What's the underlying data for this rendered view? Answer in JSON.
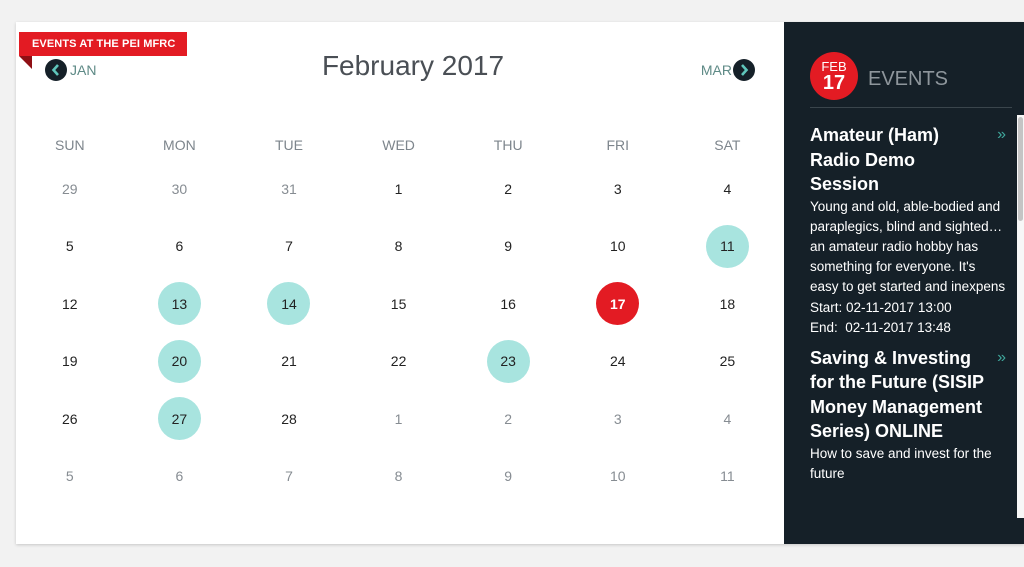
{
  "ribbon": {
    "label": "EVENTS AT THE PEI MFRC"
  },
  "calendar": {
    "title": "February 2017",
    "prev": {
      "label": "JAN",
      "icon": "chevron-left-icon"
    },
    "next": {
      "label": "MAR",
      "icon": "chevron-right-icon"
    },
    "weekdays": [
      "SUN",
      "MON",
      "TUE",
      "WED",
      "THU",
      "FRI",
      "SAT"
    ],
    "weeks": [
      [
        {
          "d": "29",
          "type": "other"
        },
        {
          "d": "30",
          "type": "other"
        },
        {
          "d": "31",
          "type": "other"
        },
        {
          "d": "1",
          "type": "normal"
        },
        {
          "d": "2",
          "type": "normal"
        },
        {
          "d": "3",
          "type": "normal"
        },
        {
          "d": "4",
          "type": "normal"
        }
      ],
      [
        {
          "d": "5",
          "type": "normal"
        },
        {
          "d": "6",
          "type": "normal"
        },
        {
          "d": "7",
          "type": "normal"
        },
        {
          "d": "8",
          "type": "normal"
        },
        {
          "d": "9",
          "type": "normal"
        },
        {
          "d": "10",
          "type": "normal"
        },
        {
          "d": "11",
          "type": "event"
        }
      ],
      [
        {
          "d": "12",
          "type": "normal"
        },
        {
          "d": "13",
          "type": "event"
        },
        {
          "d": "14",
          "type": "event"
        },
        {
          "d": "15",
          "type": "normal"
        },
        {
          "d": "16",
          "type": "normal"
        },
        {
          "d": "17",
          "type": "today"
        },
        {
          "d": "18",
          "type": "normal"
        }
      ],
      [
        {
          "d": "19",
          "type": "normal"
        },
        {
          "d": "20",
          "type": "event"
        },
        {
          "d": "21",
          "type": "normal"
        },
        {
          "d": "22",
          "type": "normal"
        },
        {
          "d": "23",
          "type": "event"
        },
        {
          "d": "24",
          "type": "normal"
        },
        {
          "d": "25",
          "type": "normal"
        }
      ],
      [
        {
          "d": "26",
          "type": "normal"
        },
        {
          "d": "27",
          "type": "event"
        },
        {
          "d": "28",
          "type": "normal"
        },
        {
          "d": "1",
          "type": "other"
        },
        {
          "d": "2",
          "type": "other"
        },
        {
          "d": "3",
          "type": "other"
        },
        {
          "d": "4",
          "type": "other"
        }
      ],
      [
        {
          "d": "5",
          "type": "other"
        },
        {
          "d": "6",
          "type": "other"
        },
        {
          "d": "7",
          "type": "other"
        },
        {
          "d": "8",
          "type": "other"
        },
        {
          "d": "9",
          "type": "other"
        },
        {
          "d": "10",
          "type": "other"
        },
        {
          "d": "11",
          "type": "other"
        }
      ]
    ]
  },
  "sidebar": {
    "badge": {
      "month": "FEB",
      "day": "17"
    },
    "title": "EVENTS",
    "more_icon": "»",
    "events": [
      {
        "title": "Amateur (Ham) Radio Demo Session",
        "description": "Young and old, able-bodied and paraplegics, blind and sighted…an amateur radio hobby has something for everyone. It's easy to get started and inexpens",
        "start": "Start: 02-11-2017 13:00",
        "end": "End:  02-11-2017 13:48"
      },
      {
        "title": "Saving & Investing for the Future (SISIP Money Management Series) ONLINE",
        "description": "How to save and invest for the future",
        "start": "",
        "end": ""
      }
    ]
  },
  "colors": {
    "brand_red": "#e31b23",
    "event_teal": "#a8e4df",
    "sidebar_bg": "#152028",
    "accent_teal": "#3fa79c"
  }
}
